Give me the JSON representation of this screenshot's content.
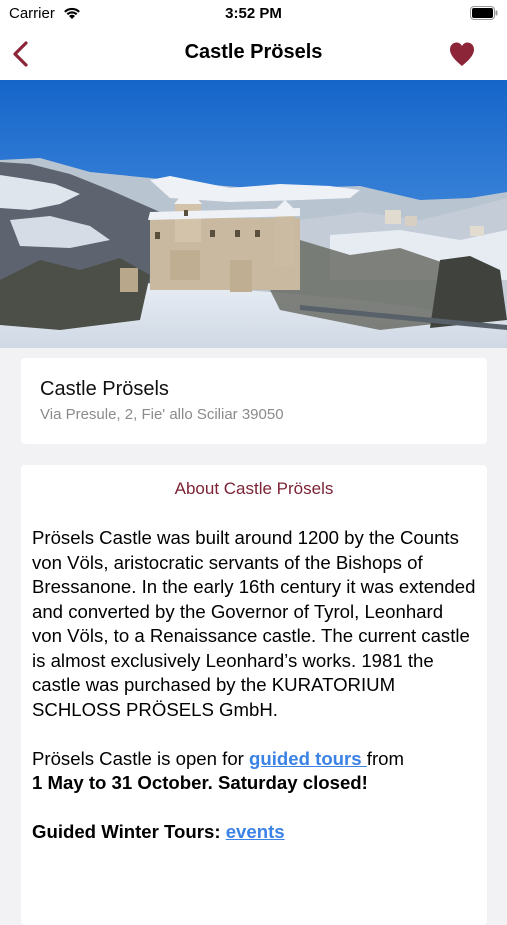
{
  "status": {
    "carrier": "Carrier",
    "time": "3:52 PM"
  },
  "nav": {
    "title": "Castle Prösels",
    "back_icon": "chevron-left-icon",
    "favorite_icon": "heart-icon"
  },
  "colors": {
    "accent": "#8c2538",
    "link": "#3b82e6",
    "sky": "#1b74d4"
  },
  "carousel": {
    "page_count": 2,
    "current_page": 1
  },
  "place": {
    "name": "Castle Prösels",
    "address": "Via Presule, 2, Fie' allo Sciliar 39050"
  },
  "about": {
    "title": "About Castle Prösels",
    "paragraph1": "Prösels Castle was built around 1200 by the Counts von Völs, aristocratic servants of the Bishops of Bressanone. In the early 16th century it was extended and converted by the Governor of Tyrol, Leonhard von Völs, to a Renaissance castle. The current castle is almost exclusively Leonhard’s works. 1981 the castle was purchased by the KURATORIUM SCHLOSS PRÖSELS GmbH.",
    "tours_prefix": "Prösels Castle is open for ",
    "tours_link": "guided tours ",
    "tours_suffix": "from",
    "tours_dates": "1 May to 31 October.  Saturday closed!",
    "winter_label": "Guided Winter Tours: ",
    "winter_link": "events"
  }
}
